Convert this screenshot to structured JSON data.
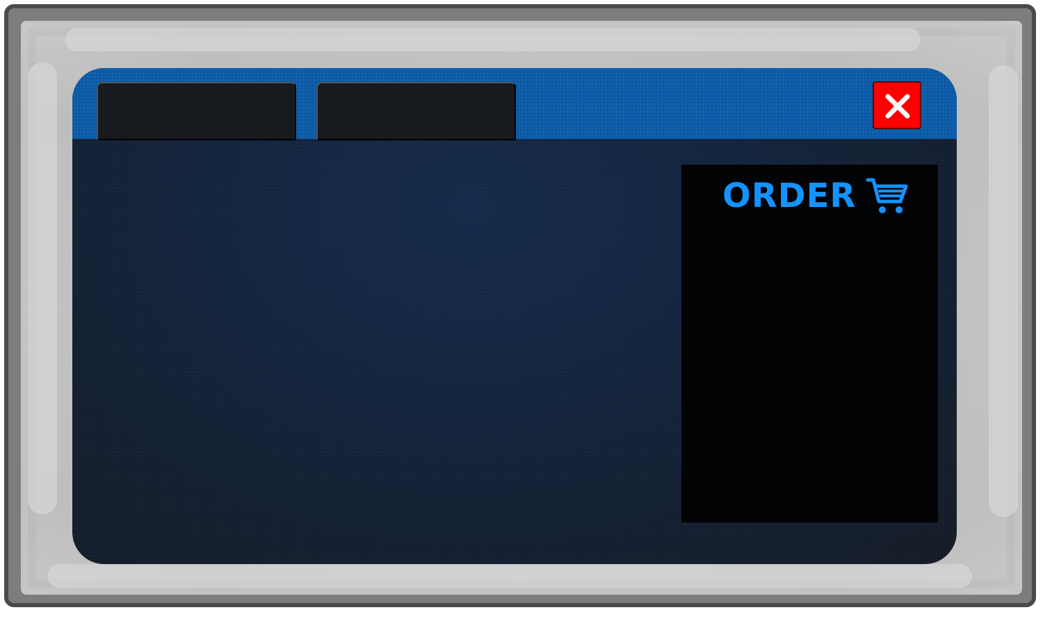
{
  "tabs": [
    {
      "label": ""
    },
    {
      "label": ""
    }
  ],
  "order_panel": {
    "title": "ORDER",
    "cart_icon": "shopping-cart-icon"
  },
  "close_button": {
    "icon": "close-icon"
  },
  "colors": {
    "frame_border": "#4a4a4a",
    "frame_fill": "#b9b9b9",
    "header_blue": "#0b5aa6",
    "body_dark": "#151c26",
    "tab_dark": "#171a1f",
    "panel_dark": "#020305",
    "accent_blue": "#1493ff",
    "close_red": "#ff0000"
  }
}
